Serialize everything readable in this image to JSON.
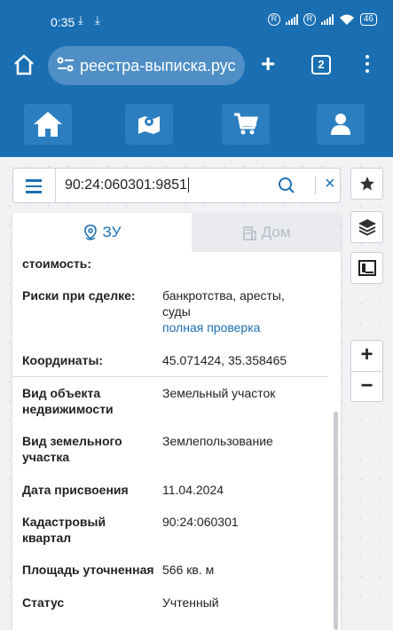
{
  "status_bar": {
    "time": "0:35",
    "battery": "46"
  },
  "browser": {
    "url": "реестра-выписка.рус",
    "tab_count": "2"
  },
  "search": {
    "query": "90:24:060301:9851"
  },
  "tabs": [
    {
      "label": "ЗУ",
      "active": true
    },
    {
      "label": "Дом",
      "active": false
    }
  ],
  "rows": {
    "cost_label": "стоимость:",
    "risks_label": "Риски при сделке:",
    "risks_value": "банкротства, аресты, суды",
    "risks_link": "полная проверка",
    "coords_label": "Координаты:",
    "coords_value": "45.071424, 35.358465",
    "object_type_label": "Вид объекта недвижимости",
    "object_type_value": "Земельный участок",
    "land_type_label": "Вид земельного участка",
    "land_type_value": "Землепользование",
    "date_label": "Дата присвоения",
    "date_value": "11.04.2024",
    "quarter_label": "Кадастровый квартал",
    "quarter_value": "90:24:060301",
    "area_label": "Площадь уточненная",
    "area_value": "566 кв. м",
    "status_label": "Статус",
    "status_value": "Учтенный"
  },
  "map_controls": {
    "zoom_in": "+",
    "zoom_out": "−"
  }
}
